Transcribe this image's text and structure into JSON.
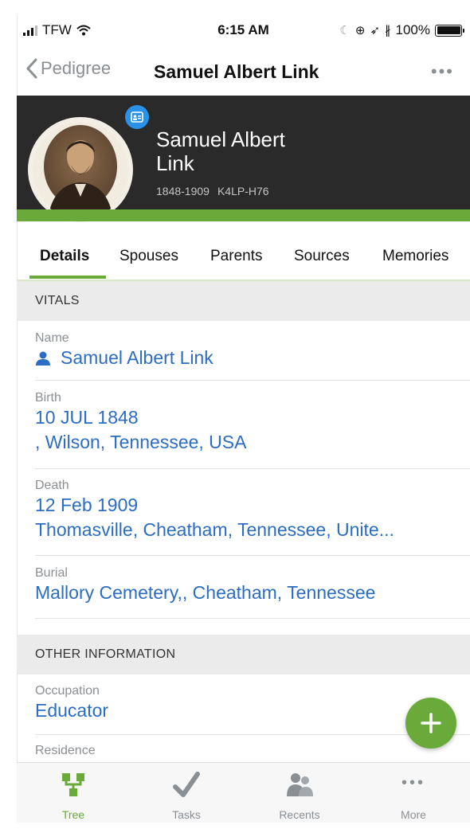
{
  "status_bar": {
    "carrier": "TFW",
    "time": "6:15 AM",
    "battery": "100%"
  },
  "nav": {
    "back_label": "Pedigree",
    "title": "Samuel Albert Link",
    "more_icon": "ellipsis-icon"
  },
  "person": {
    "name_line1": "Samuel Albert",
    "name_line2": "Link",
    "lifespan": "1848-1909",
    "id": "K4LP-H76"
  },
  "tabs": [
    "Details",
    "Spouses",
    "Parents",
    "Sources",
    "Memories"
  ],
  "active_tab": "Details",
  "vitals": {
    "header": "VITALS",
    "name_label": "Name",
    "name_value": "Samuel Albert Link",
    "birth_label": "Birth",
    "birth_date": "10 JUL 1848",
    "birth_place": ", Wilson, Tennessee, USA",
    "death_label": "Death",
    "death_date": "12 Feb 1909",
    "death_place": "Thomasville, Cheatham, Tennessee, Unite...",
    "burial_label": "Burial",
    "burial_place": "Mallory Cemetery,, Cheatham, Tennessee"
  },
  "other": {
    "header": "OTHER INFORMATION",
    "occupation_label": "Occupation",
    "occupation_value": "Educator",
    "residence_label": "Residence"
  },
  "tabbar": {
    "tree": "Tree",
    "tasks": "Tasks",
    "recents": "Recents",
    "more": "More"
  },
  "colors": {
    "accent_green": "#6aaa3a",
    "link_blue": "#2b6cc4",
    "header_dark": "#2a2a2a",
    "badge_blue": "#2a92e6"
  }
}
